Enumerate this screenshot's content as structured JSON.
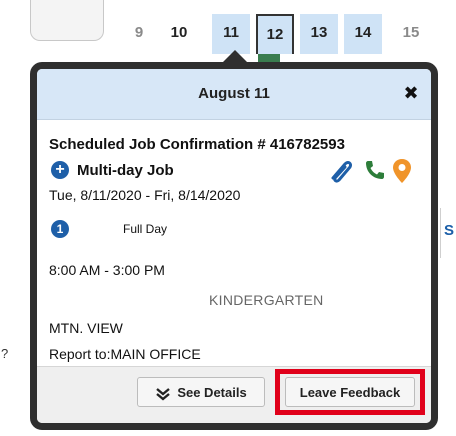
{
  "calendar": {
    "days": [
      "9",
      "10",
      "11",
      "12",
      "13",
      "14",
      "15"
    ],
    "selected_day": "12"
  },
  "popover": {
    "title": "August 11",
    "close_glyph": "✖",
    "job_header": "Scheduled Job  Confirmation # 416782593",
    "plus_glyph": "+",
    "multi_day_label": "Multi-day Job",
    "date_range": "Tue, 8/11/2020 - Fri, 8/14/2020",
    "day_number": "1",
    "day_type": "Full Day",
    "time_range": "8:00 AM - 3:00 PM",
    "assignment": "KINDERGARTEN",
    "location": "MTN. VIEW",
    "report_to": "Report to:MAIN OFFICE"
  },
  "buttons": {
    "see_details": "See Details",
    "leave_feedback": "Leave Feedback"
  },
  "edge_fragments": {
    "right_char": "S",
    "left_char": "?"
  },
  "colors": {
    "header_bg": "#d7e7f7",
    "highlight_day_bg": "#cfe3f6",
    "accent_blue": "#1e5fa8",
    "paperclip": "#1e5fa8",
    "phone": "#2d7d3a",
    "pin": "#f0942a",
    "feedback_outline": "#e0001a",
    "popover_border": "#2f2f2f"
  },
  "icons": [
    "close-icon",
    "plus-circle-icon",
    "paperclip-icon",
    "phone-icon",
    "map-pin-icon",
    "number-one-icon",
    "double-chevron-down-icon"
  ]
}
